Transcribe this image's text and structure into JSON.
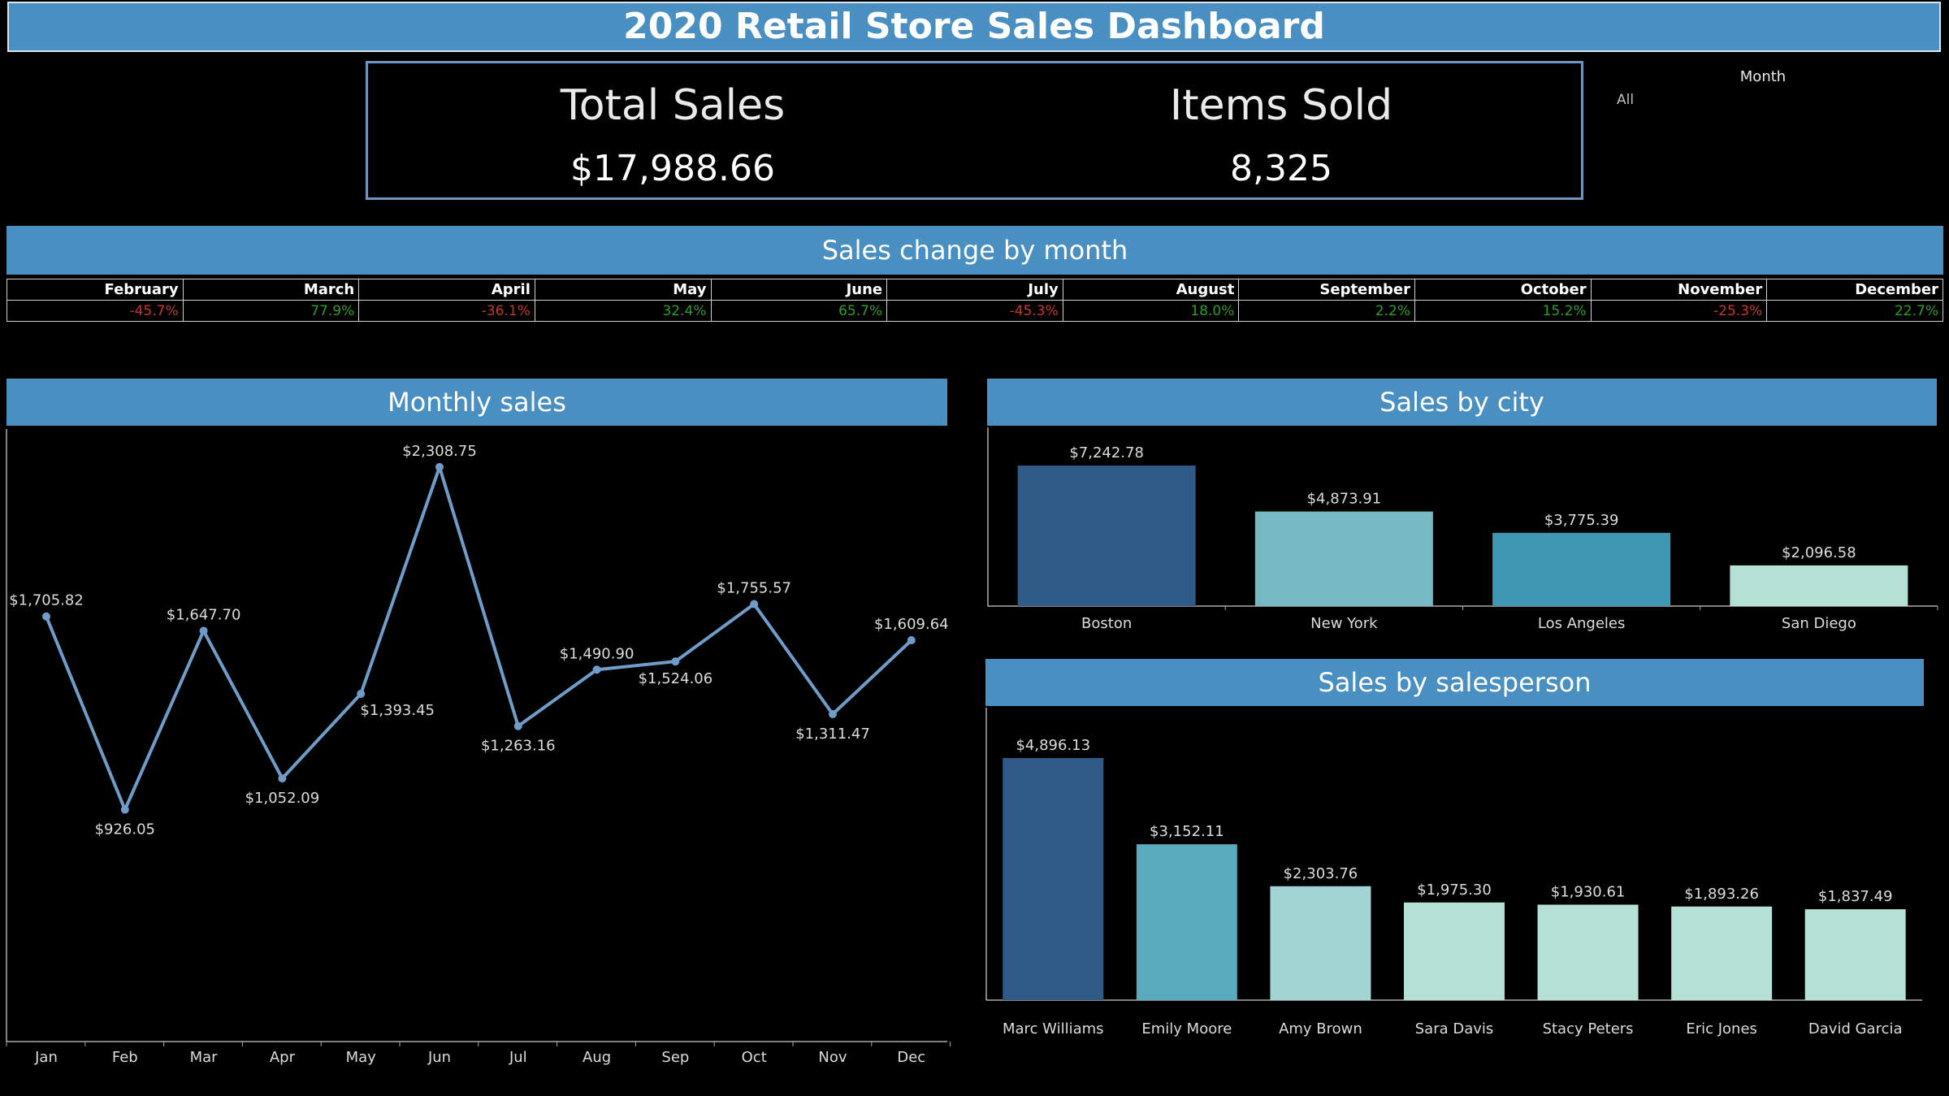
{
  "header": {
    "title": "2020 Retail Store Sales Dashboard"
  },
  "kpis": {
    "total_sales_label": "Total Sales",
    "total_sales_value": "$17,988.66",
    "items_sold_label": "Items Sold",
    "items_sold_value": "8,325"
  },
  "filter": {
    "label": "Month",
    "value": "All"
  },
  "sales_change": {
    "title": "Sales change by month",
    "months": [
      "February",
      "March",
      "April",
      "May",
      "June",
      "July",
      "August",
      "September",
      "October",
      "November",
      "December"
    ],
    "values": [
      "-45.7%",
      "77.9%",
      "-36.1%",
      "32.4%",
      "65.7%",
      "-45.3%",
      "18.0%",
      "2.2%",
      "15.2%",
      "-25.3%",
      "22.7%"
    ]
  },
  "monthly_sales": {
    "title": "Monthly  sales"
  },
  "sales_by_city": {
    "title": "Sales by  city"
  },
  "sales_by_salesperson": {
    "title": "Sales by salesperson"
  },
  "colors": {
    "band": "#4a8fc1",
    "line": "#6f9cc9",
    "positive": "#2e9b2e",
    "negative": "#c0392b",
    "dark_blue": "#2f5986",
    "teal": "#4fa9be",
    "light_teal": "#74b9c4",
    "pale": "#b5e0d5"
  },
  "chart_data": [
    {
      "type": "line",
      "categories": [
        "Jan",
        "Feb",
        "Mar",
        "Apr",
        "May",
        "Jun",
        "Jul",
        "Aug",
        "Sep",
        "Oct",
        "Nov",
        "Dec"
      ],
      "values": [
        1705.82,
        926.05,
        1647.7,
        1052.09,
        1393.45,
        2308.75,
        1263.16,
        1490.9,
        1524.06,
        1755.57,
        1311.47,
        1609.64
      ],
      "labels": [
        "$1,705.82",
        "$926.05",
        "$1,647.70",
        "$1,052.09",
        "$1,393.45",
        "$2,308.75",
        "$1,263.16",
        "$1,490.90",
        "$1,524.06",
        "$1,755.57",
        "$1,311.47",
        "$1,609.64"
      ],
      "ylim": [
        0,
        2400
      ],
      "grid": false
    },
    {
      "type": "bar",
      "categories": [
        "Boston",
        "New York",
        "Los Angeles",
        "San Diego"
      ],
      "values": [
        7242.78,
        4873.91,
        3775.39,
        2096.58
      ],
      "labels": [
        "$7,242.78",
        "$4,873.91",
        "$3,775.39",
        "$2,096.58"
      ],
      "colors": [
        "#2f5986",
        "#74b9c4",
        "#3f97b1",
        "#b5e0d5"
      ],
      "ylim": [
        0,
        7242.78
      ],
      "grid": false
    },
    {
      "type": "bar",
      "categories": [
        "Marc Williams",
        "Emily Moore",
        "Amy Brown",
        "Sara Davis",
        "Stacy Peters",
        "Eric Jones",
        "David Garcia"
      ],
      "values": [
        4896.13,
        3152.11,
        2303.76,
        1975.3,
        1930.61,
        1893.26,
        1837.49
      ],
      "labels": [
        "$4,896.13",
        "$3,152.11",
        "$2,303.76",
        "$1,975.30",
        "$1,930.61",
        "$1,893.26",
        "$1,837.49"
      ],
      "colors": [
        "#2f5986",
        "#59aabd",
        "#a3d4d4",
        "#b5e0d5",
        "#b5e0d5",
        "#b5e0d5",
        "#b5e0d5"
      ],
      "ylim": [
        0,
        4896.13
      ],
      "grid": false
    }
  ]
}
